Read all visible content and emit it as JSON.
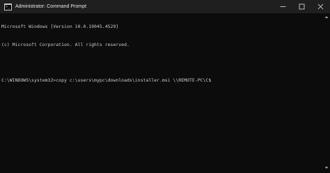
{
  "window": {
    "title": "Administrator: Command Prompt",
    "icon": "cmd-icon",
    "controls": [
      "minimize-icon",
      "maximize-icon",
      "close-icon"
    ]
  },
  "console": {
    "lines": [
      "Microsoft Windows [Version 10.0.19045.4529]",
      "(c) Microsoft Corporation. All rights reserved.",
      "",
      "C:\\WINDOWS\\system32>copy c:\\users\\mypc\\downloads\\installer.msi \\\\REMOTE-PC\\C$"
    ]
  },
  "colors": {
    "background": "#0c0c0c",
    "titlebar": "#1f1f1f",
    "text": "#cccccc"
  }
}
